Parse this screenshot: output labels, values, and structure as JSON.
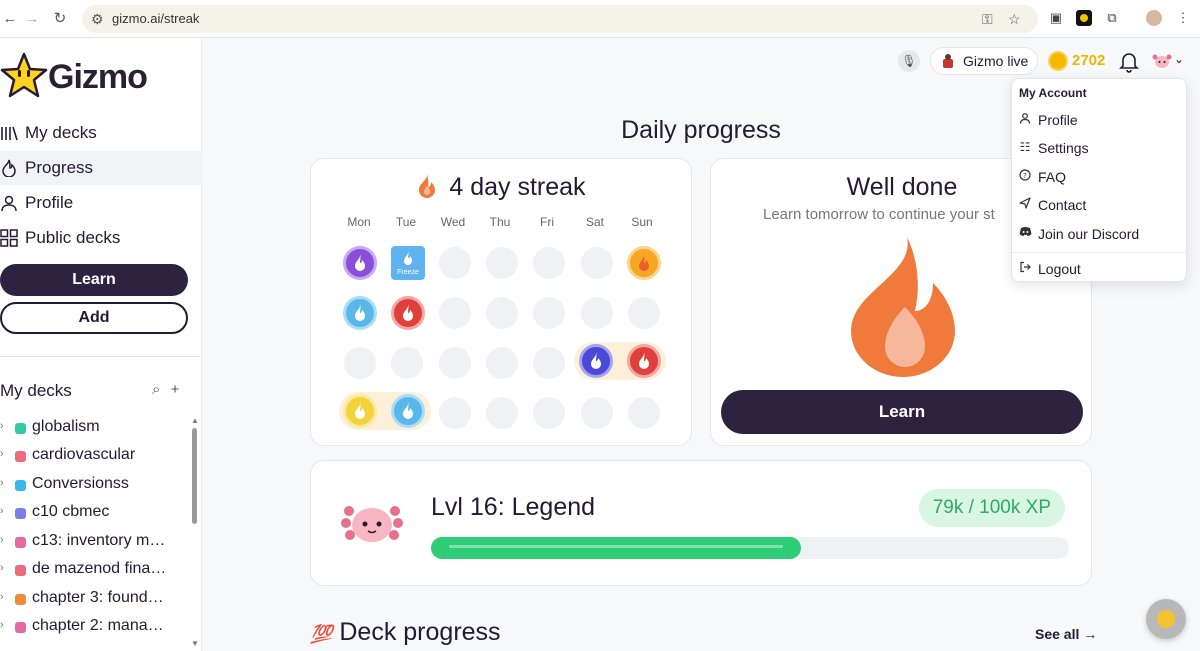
{
  "browser": {
    "url": "gizmo.ai/streak"
  },
  "app": {
    "name": "Gizmo"
  },
  "sidebar": {
    "nav": [
      {
        "label": "My decks"
      },
      {
        "label": "Progress"
      },
      {
        "label": "Profile"
      },
      {
        "label": "Public decks"
      }
    ],
    "learn_button": "Learn",
    "add_button": "Add",
    "my_decks_title": "My decks",
    "decks": [
      {
        "name": "globalism",
        "color": "#34c8a5"
      },
      {
        "name": "cardiovascular",
        "color": "#ec6b7f"
      },
      {
        "name": "Conversionss",
        "color": "#3cb6ec"
      },
      {
        "name": "c10 cbmec",
        "color": "#7b7fe8"
      },
      {
        "name": "c13: inventory m…",
        "color": "#e36aa6"
      },
      {
        "name": "de mazenod fina…",
        "color": "#ec6b7f"
      },
      {
        "name": "chapter 3: found…",
        "color": "#f08a3c"
      },
      {
        "name": "chapter 2: mana…",
        "color": "#e36aa6"
      }
    ]
  },
  "topbar": {
    "live_label": "Gizmo live",
    "coins": "2702"
  },
  "main": {
    "title": "Daily progress",
    "streak": {
      "title": "4 day streak",
      "days": [
        "Mon",
        "Tue",
        "Wed",
        "Thu",
        "Fri",
        "Sat",
        "Sun"
      ],
      "freeze_label": "Freeze"
    },
    "well_done": {
      "title": "Well done",
      "subtitle": "Learn tomorrow to continue your st",
      "button": "Learn"
    },
    "level": {
      "title": "Lvl 16: Legend",
      "xp": "79k / 100k XP",
      "progress": 0.58
    },
    "deck_progress": {
      "title": "Deck progress",
      "see_all": "See all"
    }
  },
  "dropdown": {
    "header": "My Account",
    "items": [
      {
        "label": "Profile",
        "icon": "person-icon"
      },
      {
        "label": "Settings",
        "icon": "sliders-icon"
      },
      {
        "label": "FAQ",
        "icon": "help-circle-icon"
      },
      {
        "label": "Contact",
        "icon": "send-icon"
      },
      {
        "label": "Join our Discord",
        "icon": "discord-icon"
      },
      {
        "label": "Logout",
        "icon": "logout-icon"
      }
    ]
  },
  "colors": {
    "brand_dark": "#2d2340",
    "accent_orange": "#f07a3c",
    "xp_green": "#2fcc78",
    "coin_gold": "#f0b400"
  }
}
